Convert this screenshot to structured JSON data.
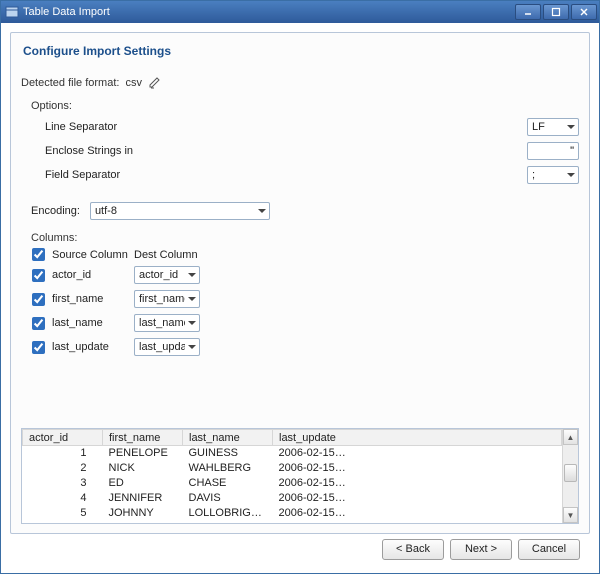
{
  "window": {
    "title": "Table Data Import"
  },
  "heading": "Configure Import Settings",
  "detected": {
    "label": "Detected file format:",
    "value": "csv"
  },
  "options": {
    "label": "Options:",
    "line_separator": {
      "label": "Line Separator",
      "value": "LF"
    },
    "enclose_strings": {
      "label": "Enclose Strings in",
      "value": "\""
    },
    "field_separator": {
      "label": "Field Separator",
      "value": ";"
    }
  },
  "encoding": {
    "label": "Encoding:",
    "value": "utf-8"
  },
  "columns": {
    "label": "Columns:",
    "source_header": "Source Column",
    "dest_header": "Dest Column",
    "rows": [
      {
        "checked": true,
        "source": "actor_id",
        "dest": "actor_id"
      },
      {
        "checked": true,
        "source": "first_name",
        "dest": "first_name"
      },
      {
        "checked": true,
        "source": "last_name",
        "dest": "last_name"
      },
      {
        "checked": true,
        "source": "last_update",
        "dest": "last_updat"
      }
    ]
  },
  "preview": {
    "headers": [
      "actor_id",
      "first_name",
      "last_name",
      "last_update"
    ],
    "rows": [
      [
        "1",
        "PENELOPE",
        "GUINESS",
        "2006-02-15…"
      ],
      [
        "2",
        "NICK",
        "WAHLBERG",
        "2006-02-15…"
      ],
      [
        "3",
        "ED",
        "CHASE",
        "2006-02-15…"
      ],
      [
        "4",
        "JENNIFER",
        "DAVIS",
        "2006-02-15…"
      ],
      [
        "5",
        "JOHNNY",
        "LOLLOBRIG…",
        "2006-02-15…"
      ]
    ]
  },
  "buttons": {
    "back": "< Back",
    "next": "Next >",
    "cancel": "Cancel"
  }
}
